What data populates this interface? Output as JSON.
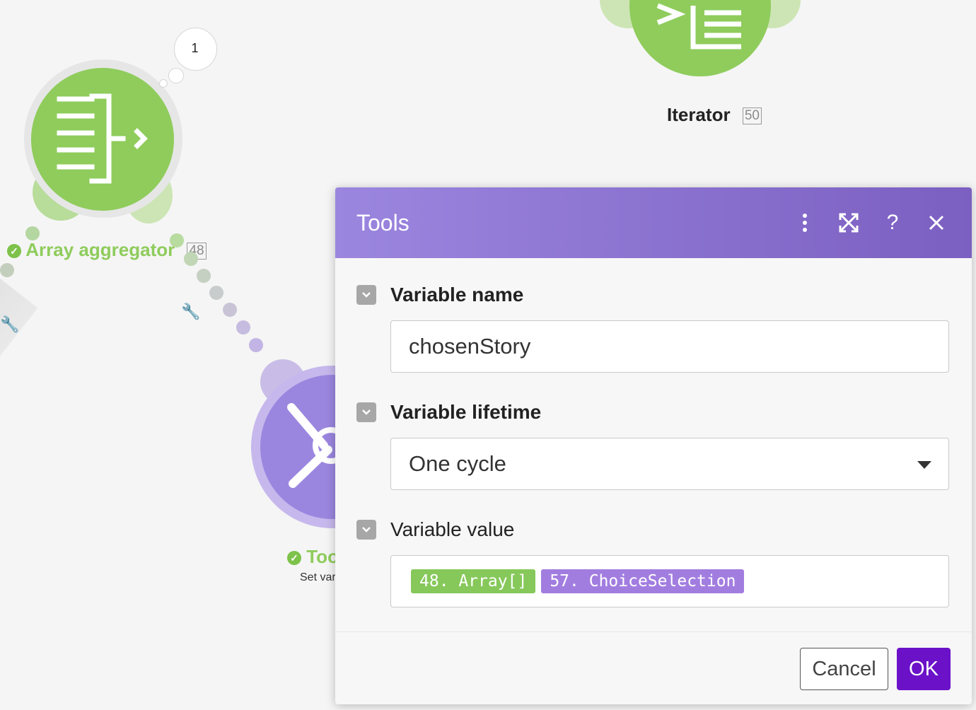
{
  "canvas": {
    "aggregator": {
      "label": "Array aggregator",
      "id": "48",
      "bubble_count": "1"
    },
    "iterator": {
      "label": "Iterator",
      "id": "50"
    },
    "tools_node": {
      "label": "Too",
      "sublabel": "Set var"
    }
  },
  "dialog": {
    "title": "Tools",
    "fields": [
      {
        "label": "Variable name",
        "value": "chosenStory"
      },
      {
        "label": "Variable lifetime",
        "value": "One cycle"
      },
      {
        "label": "Variable value",
        "tokens": [
          "48. Array[]",
          "57. ChoiceSelection"
        ]
      }
    ],
    "cancel_label": "Cancel",
    "ok_label": "OK"
  },
  "colors": {
    "green": "#8fcc5c",
    "purple": "#9b86df",
    "ok": "#6b12c9"
  }
}
